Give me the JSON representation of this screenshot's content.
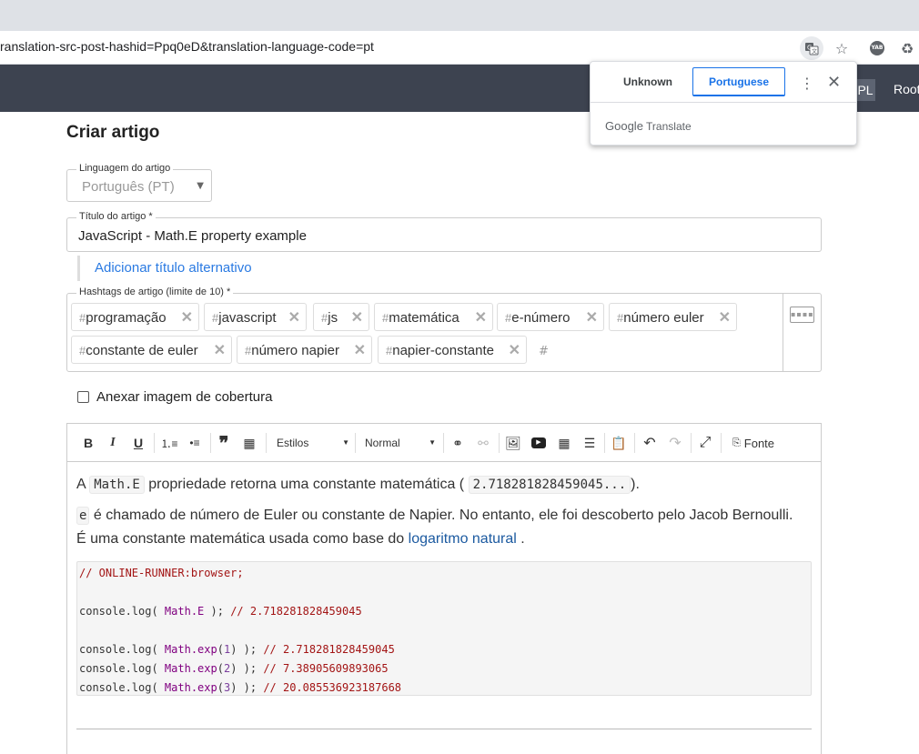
{
  "browser": {
    "url": "ranslation-src-post-hashid=Ppq0eD&translation-language-code=pt",
    "yab_label": "YAB"
  },
  "appbar": {
    "pl_label": "PL",
    "root_label": "Root"
  },
  "translate_popup": {
    "tab_unknown": "Unknown",
    "tab_portuguese": "Portuguese",
    "brand_google": "Google",
    "brand_translate": "Translate"
  },
  "form": {
    "page_title": "Criar artigo",
    "lang_legend": "Linguagem do artigo",
    "lang_value": "Português (PT)",
    "title_legend": "Título do artigo *",
    "title_value": "JavaScript - Math.E property example",
    "alt_title_link": "Adicionar título alternativo",
    "tags_legend": "Hashtags de artigo (limite de 10) *",
    "tags": [
      "programação",
      "javascript",
      "js",
      "matemática",
      "e-número",
      "número euler",
      "constante de euler",
      "número napier",
      "napier-constante"
    ],
    "cover_label": "Anexar imagem de cobertura"
  },
  "toolbar": {
    "bold": "B",
    "italic": "I",
    "underline": "U",
    "styles_label": "Estilos",
    "format_label": "Normal",
    "source_label": "Fonte"
  },
  "content": {
    "p1_before": "A",
    "p1_code": "Math.E",
    "p1_middle": "propriedade retorna uma constante matemática (",
    "p1_value": "2.718281828459045...",
    "p1_after": ").",
    "p2_code": "e",
    "p2_text": "é chamado de número de Euler ou constante de Napier. No entanto, ele foi descoberto pelo Jacob Bernoulli. É uma constante matemática usada como base do",
    "p2_link": "logaritmo natural",
    "p2_end": ".",
    "code_lines": {
      "l1": "// ONLINE-RUNNER:browser;",
      "l3_a": "console.log( ",
      "l3_b": "Math.E",
      "l3_c": " ); ",
      "l3_d": "// 2.718281828459045",
      "l5_a": "console.log( ",
      "l5_b": "Math.exp",
      "l5_c": "(",
      "l5_n": "1",
      "l5_e": ") ); ",
      "l5_d": "// 2.718281828459045",
      "l6_a": "console.log( ",
      "l6_b": "Math.exp",
      "l6_c": "(",
      "l6_n": "2",
      "l6_e": ") ); ",
      "l6_d": "// 7.38905609893065",
      "l7_a": "console.log( ",
      "l7_b": "Math.exp",
      "l7_c": "(",
      "l7_n": "3",
      "l7_e": ") ); ",
      "l7_d": "// 20.085536923187668"
    }
  }
}
